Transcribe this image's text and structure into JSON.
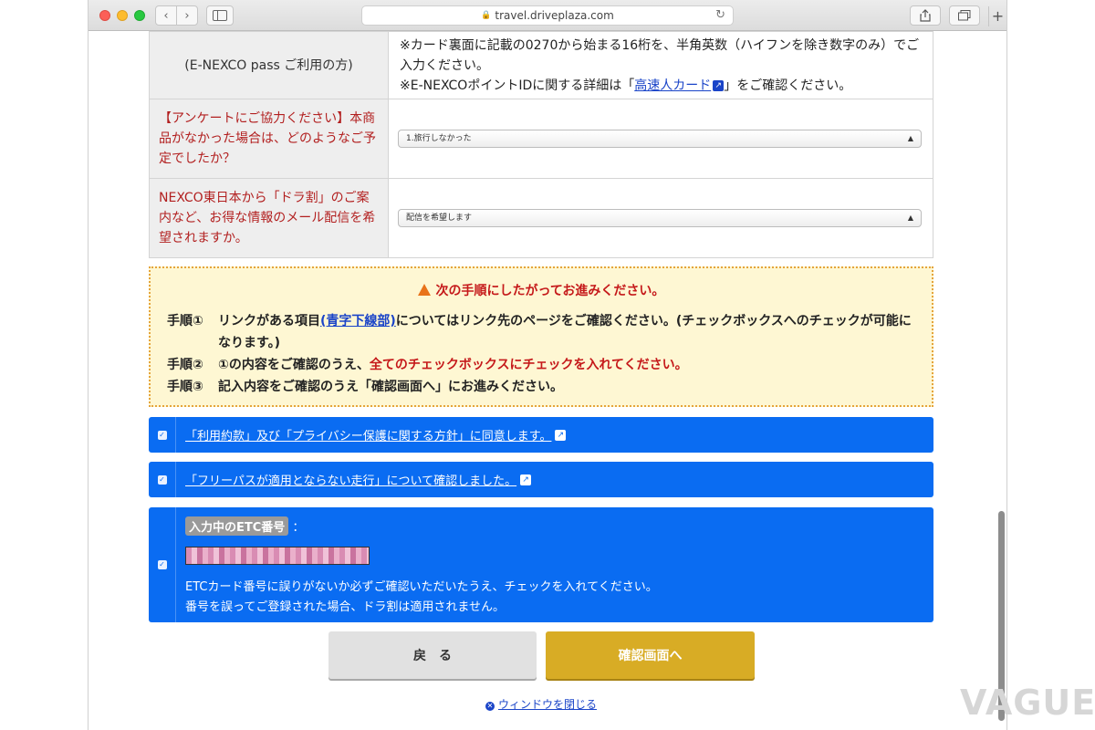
{
  "browser": {
    "url": "travel.driveplaza.com",
    "back_glyph": "‹",
    "fwd_glyph": "›",
    "new_tab_glyph": "+"
  },
  "form": {
    "row1": {
      "header": "(E-NEXCO pass ご利用の方)",
      "line1": "※カード裏面に記載の0270から始まる16桁を、半角英数（ハイフンを除き数字のみ）でご入力ください。",
      "line2_prefix": "※E-NEXCOポイントIDに関する詳細は「",
      "line2_link": "高速人カード",
      "line2_suffix": "」をご確認ください。"
    },
    "row2": {
      "header": "【アンケートにご協力ください】本商品がなかった場合は、どのようなご予定でしたか？",
      "select_value": "1.旅行しなかった"
    },
    "row3": {
      "header": "NEXCO東日本から「ドラ割」のご案内など、お得な情報のメール配信を希望されますか。",
      "select_value": "配信を希望します"
    }
  },
  "notice": {
    "title": "次の手順にしたがってお進みください。",
    "step1_label": "手順①",
    "step1_pre": "リンクがある項目",
    "step1_link": "(青字下線部)",
    "step1_post": "についてはリンク先のページをご確認ください。(チェックボックスへのチェックが可能になります。)",
    "step2_label": "手順②",
    "step2_pre": "①の内容をご確認のうえ、",
    "step2_red": "全てのチェックボックスにチェックを入れてください。",
    "step3_label": "手順③",
    "step3_text": "記入内容をご確認のうえ「確認画面へ」にお進みください。"
  },
  "checks": {
    "terms": "「利用約款」及び「プライバシー保護に関する方針」に同意します。",
    "freepass": "「フリーパスが適用とならない走行」について確認しました。",
    "etc_tag": "入力中のETC番号",
    "etc_colon": "：",
    "etc_note1": "ETCカード番号に誤りがないか必ずご確認いただいたうえ、チェックを入れてください。",
    "etc_note2": "番号を誤ってご登録された場合、ドラ割は適用されません。"
  },
  "buttons": {
    "back": "戻る",
    "confirm": "確認画面へ",
    "close_window": "ウィンドウを閉じる"
  },
  "watermark": "VAGUE",
  "colors": {
    "accent_blue": "#0a6cf2",
    "confirm_gold": "#d8ac25",
    "notice_red": "#c5191a"
  }
}
